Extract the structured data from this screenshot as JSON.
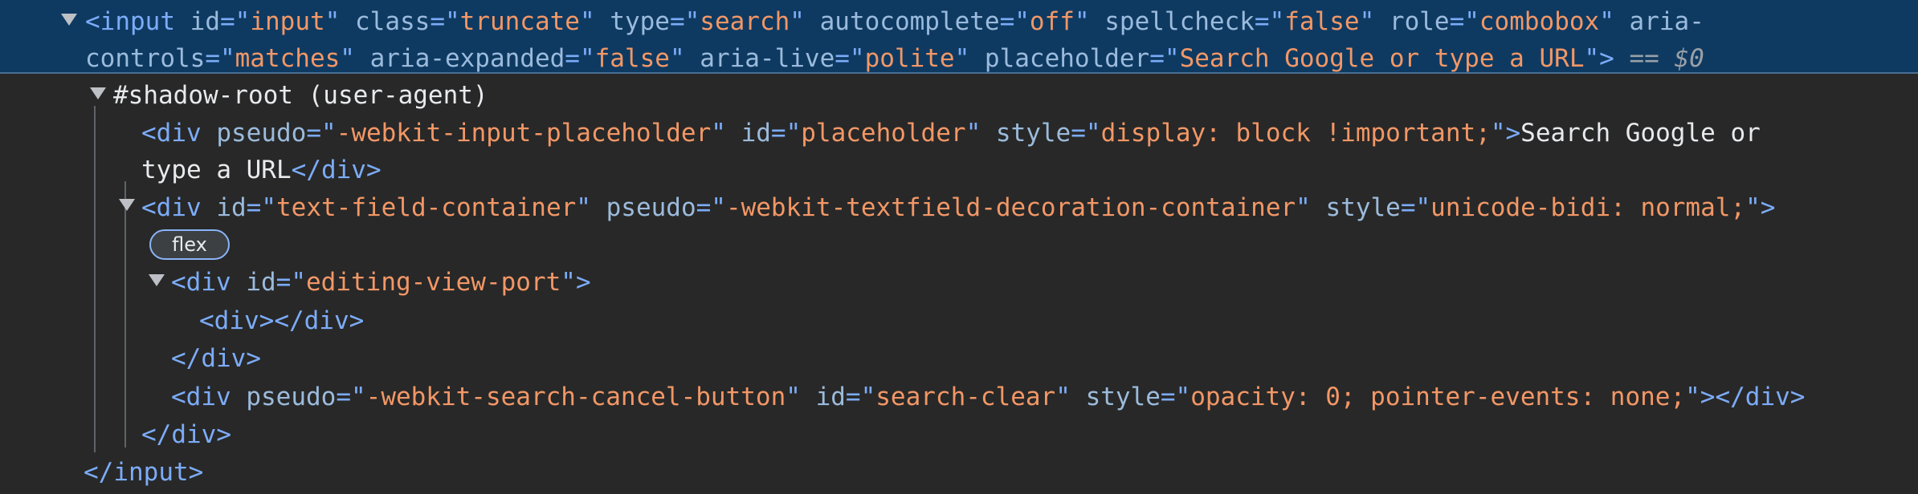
{
  "dom_tree": {
    "input_node": {
      "open_bracket": "<",
      "tag": "input",
      "attrs": [
        {
          "name": "id",
          "value": "input"
        },
        {
          "name": "class",
          "value": "truncate"
        },
        {
          "name": "type",
          "value": "search"
        },
        {
          "name": "autocomplete",
          "value": "off"
        },
        {
          "name": "spellcheck",
          "value": "false"
        },
        {
          "name": "role",
          "value": "combobox"
        },
        {
          "name": "aria-controls",
          "value": "matches"
        },
        {
          "name": "aria-expanded",
          "value": "false"
        },
        {
          "name": "aria-live",
          "value": "polite"
        },
        {
          "name": "placeholder",
          "value": "Search Google or type a URL"
        }
      ],
      "wrapped_attr_line1": "aria-",
      "wrapped_attr_line2": "controls",
      "close_bracket": ">",
      "eq_marker": " == ",
      "dollar_ref": "$0",
      "closing_tag": "</input>"
    },
    "shadow_root": {
      "label": "#shadow-root (user-agent)"
    },
    "placeholder_div": {
      "tag": "div",
      "attrs": [
        {
          "name": "pseudo",
          "value": "-webkit-input-placeholder"
        },
        {
          "name": "id",
          "value": "placeholder"
        },
        {
          "name": "style",
          "value": "display: block !important;"
        }
      ],
      "text_line1": "Search Google or",
      "text_line2": "type a URL",
      "closing_tag": "</div>"
    },
    "text_field_container": {
      "tag": "div",
      "attrs": [
        {
          "name": "id",
          "value": "text-field-container"
        },
        {
          "name": "pseudo",
          "value": "-webkit-textfield-decoration-container"
        },
        {
          "name": "style",
          "value": "unicode-bidi: normal;"
        }
      ],
      "badge": "flex",
      "closing_tag": "</div>"
    },
    "editing_view_port": {
      "tag": "div",
      "attrs": [
        {
          "name": "id",
          "value": "editing-view-port"
        }
      ],
      "child": "<div></div>",
      "closing_tag": "</div>"
    },
    "search_clear": {
      "tag": "div",
      "attrs": [
        {
          "name": "pseudo",
          "value": "-webkit-search-cancel-button"
        },
        {
          "name": "id",
          "value": "search-clear"
        },
        {
          "name": "style",
          "value": "opacity: 0; pointer-events: none;"
        }
      ],
      "closing_tag": "</div>"
    }
  },
  "colors": {
    "background": "#282828",
    "selection": "#0e3a62",
    "tag": "#7cacf8",
    "attribute_name": "#9bbbdc",
    "attribute_value": "#f29766",
    "text": "#e8eaed"
  },
  "icons": [
    "expand-triangle-icon"
  ]
}
